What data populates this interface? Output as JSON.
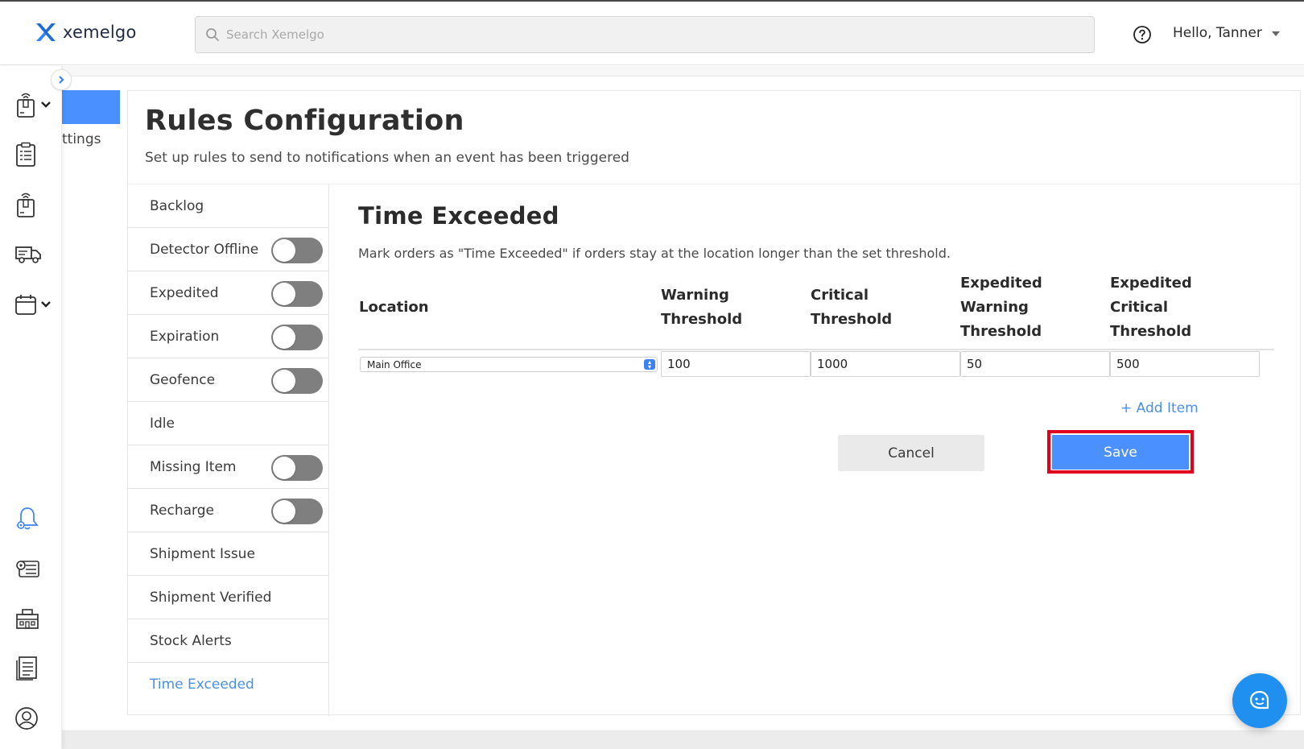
{
  "app": {
    "brand": "xemelgo",
    "accent": "#4a90ff",
    "brand_color": "#1e6bd6"
  },
  "search": {
    "placeholder": "Search Xemelgo",
    "value": ""
  },
  "header": {
    "help_icon": "question-circle-icon",
    "greeting": "Hello, Tanner"
  },
  "rail": {
    "items": [
      {
        "icon": "tag-reader-icon",
        "has_chevron": true
      },
      {
        "icon": "clipboard-list-icon",
        "has_chevron": false
      },
      {
        "icon": "tag-reader-icon",
        "has_chevron": false
      },
      {
        "icon": "truck-icon",
        "has_chevron": false
      },
      {
        "icon": "calendar-icon",
        "has_chevron": true
      },
      {
        "icon": "bell-gear-icon",
        "active": true
      },
      {
        "icon": "settings-list-icon"
      },
      {
        "icon": "building-icon"
      },
      {
        "icon": "report-list-icon"
      },
      {
        "icon": "user-circle-icon"
      }
    ]
  },
  "submenu": {
    "label": "ttings"
  },
  "page": {
    "title": "Rules Configuration",
    "subtitle": "Set up rules to send to notifications when an event has been triggered"
  },
  "rules": [
    {
      "label": "Backlog",
      "has_toggle": false,
      "enabled": false
    },
    {
      "label": "Detector Offline",
      "has_toggle": true,
      "enabled": false
    },
    {
      "label": "Expedited",
      "has_toggle": true,
      "enabled": false
    },
    {
      "label": "Expiration",
      "has_toggle": true,
      "enabled": false
    },
    {
      "label": "Geofence",
      "has_toggle": true,
      "enabled": false
    },
    {
      "label": "Idle",
      "has_toggle": false,
      "enabled": false
    },
    {
      "label": "Missing Item",
      "has_toggle": true,
      "enabled": false
    },
    {
      "label": "Recharge",
      "has_toggle": true,
      "enabled": false
    },
    {
      "label": "Shipment Issue",
      "has_toggle": false,
      "enabled": false
    },
    {
      "label": "Shipment Verified",
      "has_toggle": false,
      "enabled": false
    },
    {
      "label": "Stock Alerts",
      "has_toggle": false,
      "enabled": false
    },
    {
      "label": "Time Exceeded",
      "has_toggle": false,
      "active": true
    }
  ],
  "detail": {
    "title": "Time Exceeded",
    "description": "Mark orders as \"Time Exceeded\" if orders stay at the location longer than the set threshold.",
    "columns": {
      "location": "Location",
      "warning": [
        "Warning",
        "Threshold"
      ],
      "critical": [
        "Critical",
        "Threshold"
      ],
      "expedited_warning": [
        "Expedited",
        "Warning",
        "Threshold"
      ],
      "expedited_critical": [
        "Expedited",
        "Critical",
        "Threshold"
      ]
    },
    "row": {
      "location": "Main Office",
      "warning": "100",
      "critical": "1000",
      "expedited_warning": "50",
      "expedited_critical": "500"
    },
    "add_item": "+ Add Item",
    "cancel": "Cancel",
    "save": "Save",
    "save_highlight_color": "#e0001b"
  },
  "chat": {
    "icon": "chat-bubble-icon"
  }
}
